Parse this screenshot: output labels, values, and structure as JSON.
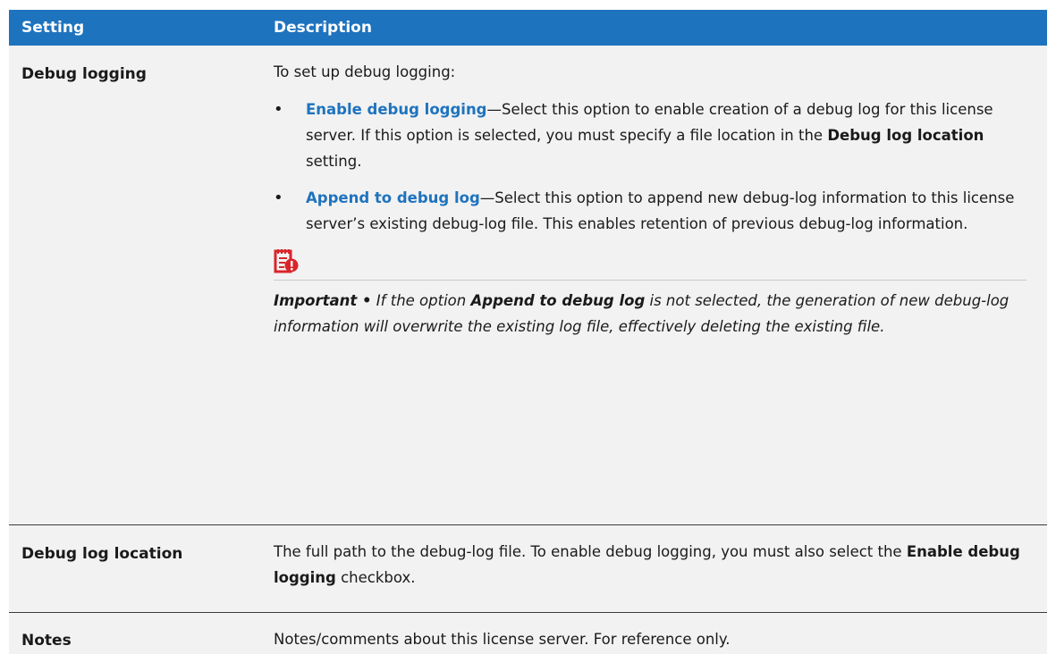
{
  "header": {
    "setting": "Setting",
    "description": "Description"
  },
  "rows": [
    {
      "setting": "Debug logging",
      "intro": "To set up debug logging:",
      "bullets": [
        {
          "term": "Enable debug logging",
          "text_before": "—Select this option to enable creation of a debug log for this license server. If this option is selected, you must specify a file location in the ",
          "bold": "Debug log location",
          "text_after": " setting."
        },
        {
          "term": "Append to debug log",
          "text": "—Select this option to append new debug-log information to this license server’s existing debug-log file. This enables retention of previous debug-log information."
        }
      ],
      "note": {
        "label": "Important •",
        "text_before": " If the option ",
        "bold": "Append to debug log",
        "text_after": " is not selected, the generation of new debug-log information will overwrite the existing log file, effectively deleting the existing file."
      }
    },
    {
      "setting": "Debug log location",
      "text_before": "The full path to the debug-log file. To enable debug logging, you must also select the ",
      "bold": "Enable debug logging",
      "text_after": " checkbox."
    },
    {
      "setting": "Notes",
      "text": "Notes/comments about this license server. For reference only."
    }
  ],
  "icons": {
    "note_icon": "important-note-icon"
  },
  "colors": {
    "header_bg": "#1e73be",
    "link": "#1e73be",
    "row_bg": "#f2f2f2",
    "icon_red": "#d9252a"
  }
}
